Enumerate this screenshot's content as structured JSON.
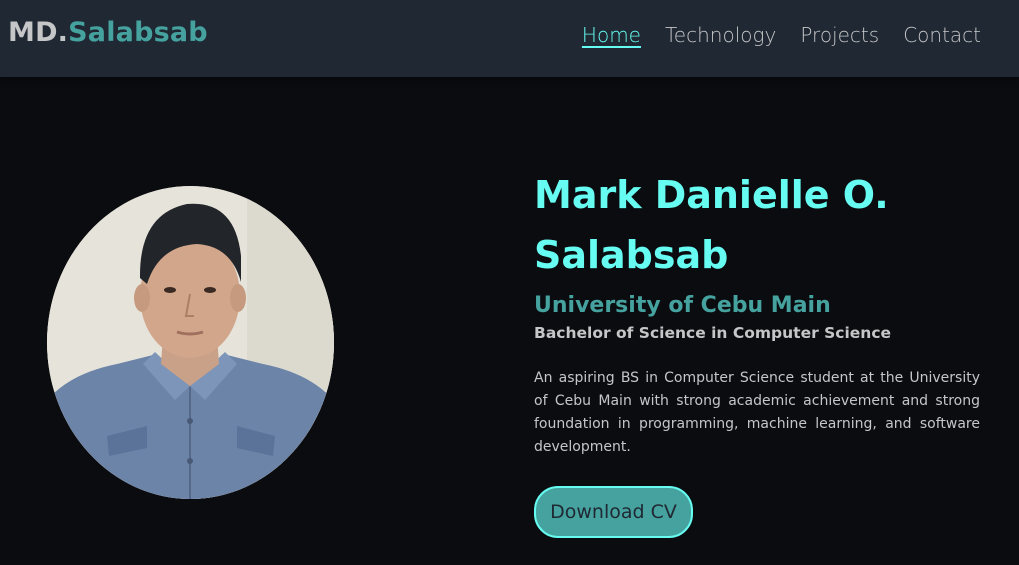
{
  "brand": {
    "prefix": "MD.",
    "suffix": "Salabsab"
  },
  "nav": {
    "items": [
      {
        "label": "Home",
        "active": true
      },
      {
        "label": "Technology",
        "active": false
      },
      {
        "label": "Projects",
        "active": false
      },
      {
        "label": "Contact",
        "active": false
      }
    ]
  },
  "hero": {
    "name_line1": "Mark Danielle O.",
    "name_line2": "Salabsab",
    "university": "University of Cebu Main",
    "degree": "Bachelor of Science in Computer Science",
    "description": "An aspiring BS in Computer Science student at the University of Cebu Main with strong academic achievement and strong foundation in programming, machine learning, and software development.",
    "cv_button": "Download CV"
  },
  "colors": {
    "accent": "#66fcf1",
    "accent_dark": "#45a29e",
    "text": "#c5c6c7",
    "nav_bg": "#1f2833",
    "page_bg": "#0b0c10"
  }
}
